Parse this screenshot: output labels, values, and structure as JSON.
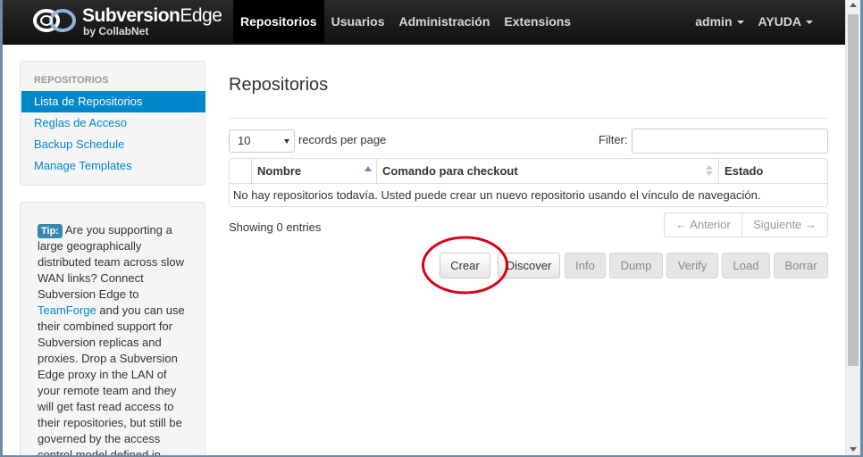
{
  "brand": {
    "name_bold": "Subversion",
    "name_light": "Edge",
    "byline": "by CollabNet"
  },
  "nav": {
    "items": [
      {
        "label": "Repositorios",
        "active": true
      },
      {
        "label": "Usuarios",
        "active": false
      },
      {
        "label": "Administración",
        "active": false
      },
      {
        "label": "Extensions",
        "active": false
      }
    ],
    "user_menu": "admin",
    "help_menu": "AYUDA"
  },
  "sidebar": {
    "header": "REPOSITORIOS",
    "items": [
      {
        "label": "Lista de Repositorios",
        "active": true
      },
      {
        "label": "Reglas de Acceso",
        "active": false
      },
      {
        "label": "Backup Schedule",
        "active": false
      },
      {
        "label": "Manage Templates",
        "active": false
      }
    ]
  },
  "tip": {
    "label": "Tip:",
    "text_before": " Are you supporting a large geographically distributed team across slow WAN links? Connect Subversion Edge to ",
    "link": "TeamForge",
    "text_after": " and you can use their combined support for Subversion replicas and proxies. Drop a Subversion Edge proxy in the LAN of your remote team and they will get fast read access to their repositories, but still be governed by the access control model defined in"
  },
  "main": {
    "title": "Repositorios",
    "page_size": "10",
    "records_per_page": "records per page",
    "filter_label": "Filter:",
    "filter_value": "",
    "table": {
      "headers": [
        "Nombre",
        "Comando para checkout",
        "Estado"
      ],
      "empty_message": "No hay repositorios todavía. Usted puede crear un nuevo repositorio usando el vínculo de navegación."
    },
    "showing": "Showing 0 entries",
    "pager": {
      "prev": "← Anterior",
      "next": "Siguiente →"
    },
    "buttons": {
      "create": "Crear",
      "discover": "Discover",
      "info": "Info",
      "dump": "Dump",
      "verify": "Verify",
      "load": "Load",
      "delete": "Borrar"
    }
  },
  "colors": {
    "accent": "#0088cc",
    "navbar": "#1b1b1b",
    "highlight": "#d9001b"
  }
}
